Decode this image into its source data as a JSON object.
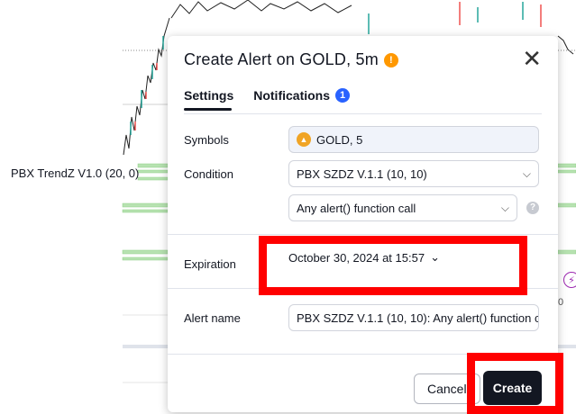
{
  "chart": {
    "indicator_label": "PBX TrendZ V1.0 (20, 0)",
    "right_edge_text": "0",
    "bolt_icon": "lightning-icon"
  },
  "dialog": {
    "title": "Create Alert on GOLD, 5m",
    "tabs": [
      {
        "label": "Settings",
        "active": true
      },
      {
        "label": "Notifications",
        "badge": "1"
      }
    ],
    "symbols": {
      "label": "Symbols",
      "value": "GOLD, 5"
    },
    "condition": {
      "label": "Condition",
      "value": "PBX SZDZ V.1.1 (10, 10)",
      "trigger": "Any alert() function call"
    },
    "expiration": {
      "label": "Expiration",
      "value": "October 30, 2024 at 15:57"
    },
    "alert_name": {
      "label": "Alert name",
      "value": "PBX SZDZ V.1.1 (10, 10): Any alert() function ca"
    },
    "buttons": {
      "cancel": "Cancel",
      "create": "Create"
    }
  },
  "colors": {
    "accent": "#2962ff",
    "warning": "#ff9800",
    "highlight": "#ff0000",
    "create_bg": "#131722"
  }
}
